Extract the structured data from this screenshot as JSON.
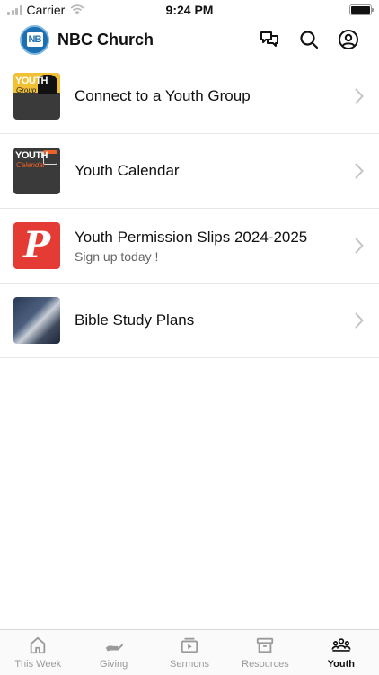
{
  "status_bar": {
    "carrier": "Carrier",
    "time": "9:24 PM"
  },
  "header": {
    "title": "NBC Church",
    "logo_text": "NB"
  },
  "list": {
    "items": [
      {
        "title": "Connect to a Youth Group",
        "subtitle": "",
        "thumb_line1": "YOUTH",
        "thumb_line2": "Group"
      },
      {
        "title": "Youth Calendar",
        "subtitle": "",
        "thumb_line1": "YOUTH",
        "thumb_line2": "Calendar"
      },
      {
        "title": "Youth Permission Slips 2024-2025",
        "subtitle": "Sign up today !",
        "thumb_line1": "P"
      },
      {
        "title": "Bible Study Plans",
        "subtitle": ""
      }
    ]
  },
  "tabbar": {
    "tabs": [
      {
        "label": "This Week",
        "icon": "home-icon",
        "active": false
      },
      {
        "label": "Giving",
        "icon": "giving-hand-icon",
        "active": false
      },
      {
        "label": "Sermons",
        "icon": "sermons-play-icon",
        "active": false
      },
      {
        "label": "Resources",
        "icon": "resources-box-icon",
        "active": false
      },
      {
        "label": "Youth",
        "icon": "youth-group-icon",
        "active": true
      }
    ]
  },
  "colors": {
    "accent": "#1c6fb0",
    "active_tab": "#111111",
    "inactive_tab": "#9a9a9a",
    "permission_red": "#e53b35"
  }
}
